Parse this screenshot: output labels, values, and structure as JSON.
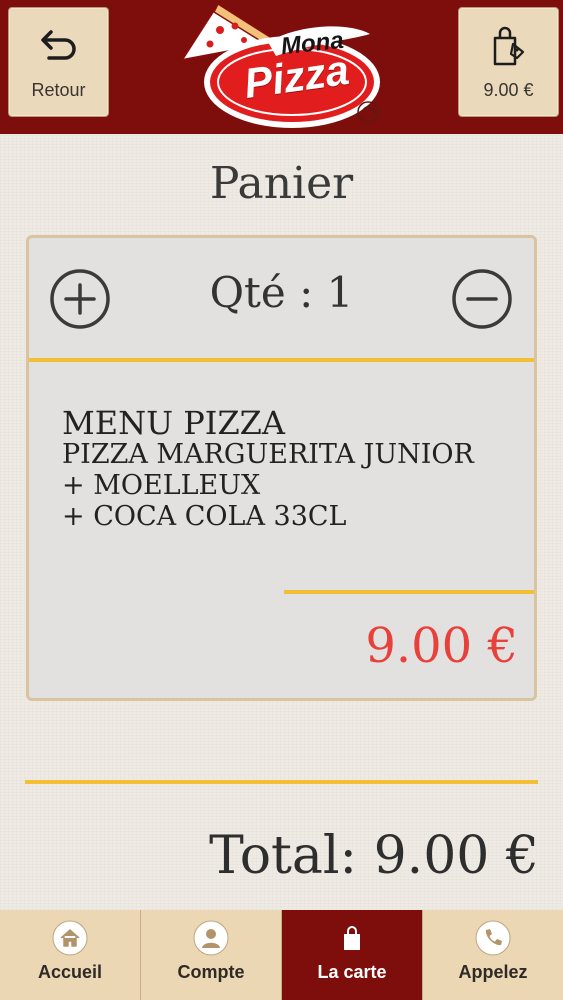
{
  "header": {
    "back_label": "Retour",
    "cart_amount": "9.00 €",
    "logo": {
      "line1": "Mona",
      "line2": "Pizza"
    }
  },
  "page": {
    "title": "Panier"
  },
  "cart": {
    "quantity_label": "Qté : 1",
    "quantity": 1,
    "item": {
      "name": "MENU PIZZA",
      "lines": [
        "PIZZA MARGUERITA JUNIOR",
        "+ MOELLEUX",
        "+ COCA COLA 33CL"
      ],
      "price": "9.00 €"
    }
  },
  "total_label": "Total: 9.00 €",
  "bottom_nav": {
    "items": [
      {
        "label": "Accueil",
        "icon": "home-icon",
        "active": false
      },
      {
        "label": "Compte",
        "icon": "user-icon",
        "active": false
      },
      {
        "label": "La carte",
        "icon": "shopping-bag-icon",
        "active": true
      },
      {
        "label": "Appelez",
        "icon": "phone-icon",
        "active": false
      }
    ]
  },
  "colors": {
    "brand_red": "#7d0e0c",
    "accent_yellow": "#f3bf36",
    "price_red": "#e8413b",
    "button_beige": "#ebd7b4"
  }
}
